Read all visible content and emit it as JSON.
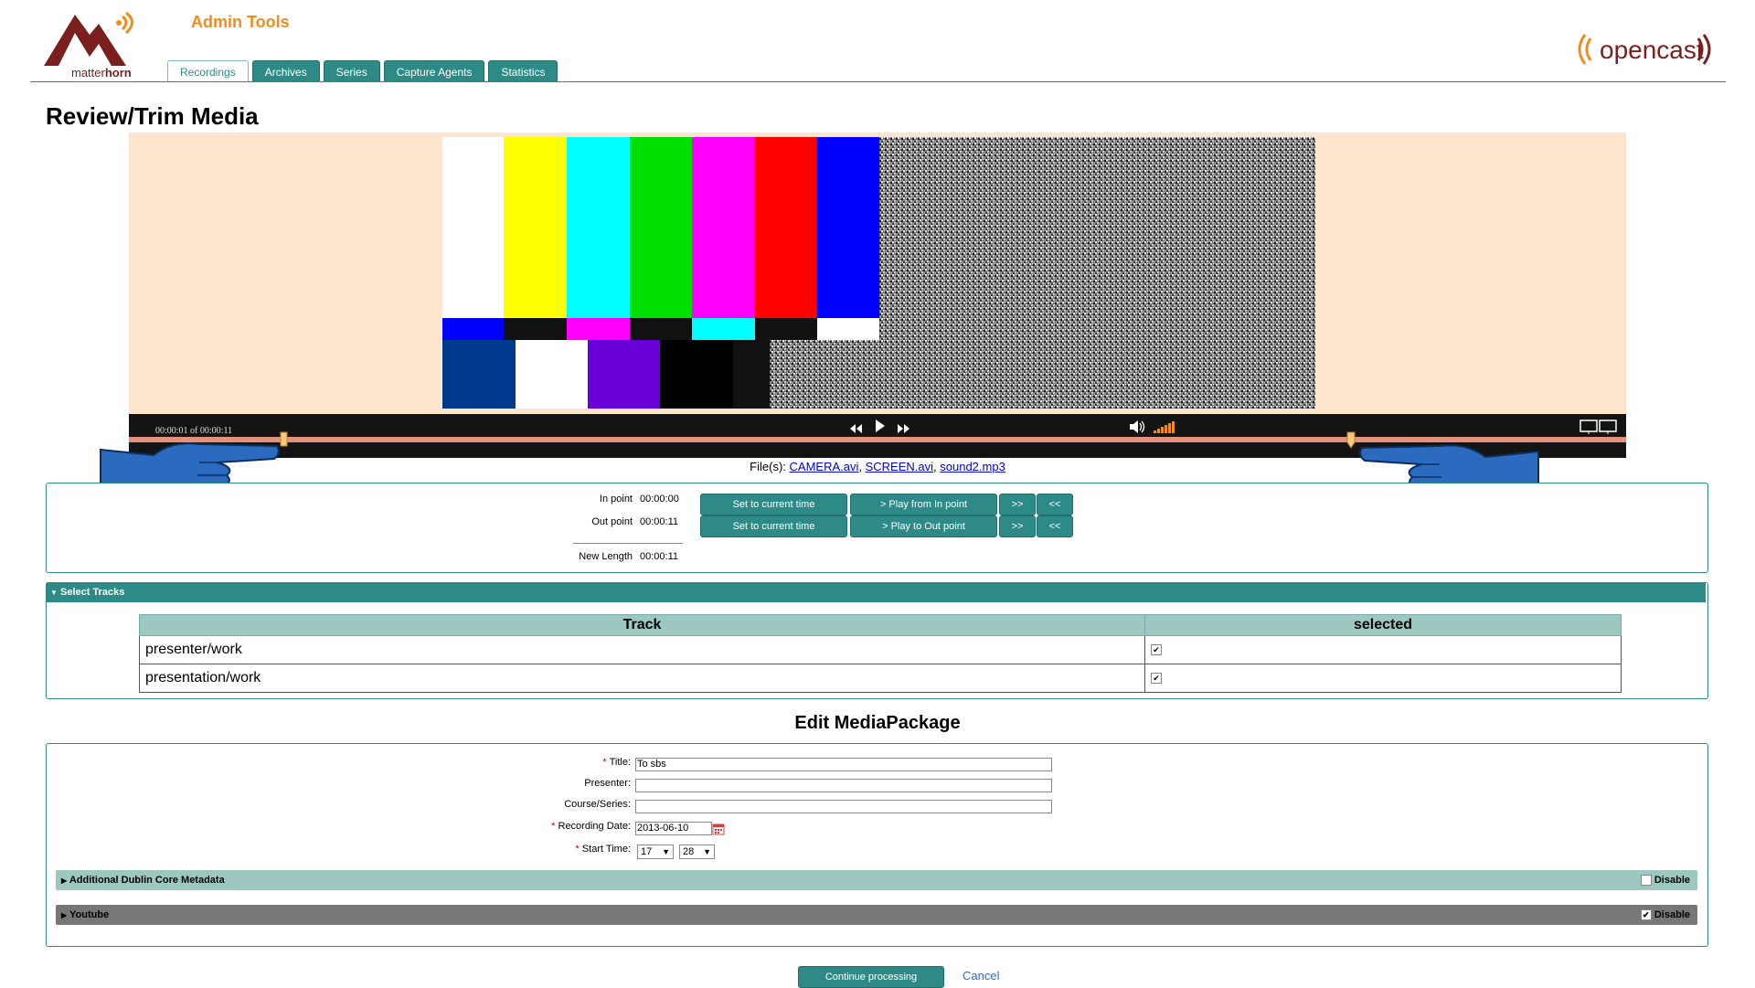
{
  "header": {
    "app_title": "Admin Tools",
    "tabs": [
      {
        "label": "Recordings",
        "active": true
      },
      {
        "label": "Archives",
        "active": false
      },
      {
        "label": "Series",
        "active": false
      },
      {
        "label": "Capture Agents",
        "active": false
      },
      {
        "label": "Statistics",
        "active": false
      }
    ],
    "brand_accent": "#f08c1e",
    "brand_teal": "#2d8a86"
  },
  "page_title": "Review/Trim Media",
  "player": {
    "time": "00:00:01  of  00:00:11",
    "files_label": "File(s):",
    "files": [
      "CAMERA.avi",
      "SCREEN.avi",
      "sound2.mp3"
    ]
  },
  "trim": {
    "in_label": "In point",
    "in_value": "00:00:00",
    "out_label": "Out point",
    "out_value": "00:00:11",
    "length_label": "New Length",
    "length_value": "00:00:11",
    "set_in": "Set to current time",
    "play_in": "> Play from In point",
    "set_out": "Set to current time",
    "play_out": "> Play to Out point",
    "fwd": ">>",
    "back": "<<"
  },
  "tracks": {
    "section_title": "Select Tracks",
    "col_track": "Track",
    "col_selected": "selected",
    "rows": [
      {
        "track": "presenter/work",
        "selected": "✔"
      },
      {
        "track": "presentation/work",
        "selected": "✔"
      }
    ]
  },
  "edit": {
    "section_title": "Edit MediaPackage",
    "title_label": "Title:",
    "title_value": "To sbs",
    "presenter_label": "Presenter:",
    "course_label": "Course/Series:",
    "date_label": "Recording Date:",
    "date_value": "2013-06-10",
    "start_label": "Start Time:",
    "start_hour": "17",
    "start_min": "28",
    "dublin_label": "Additional Dublin Core Metadata",
    "youtube_label": "Youtube",
    "disable_label": "Disable"
  },
  "actions": {
    "continue": "Continue processing",
    "cancel": "Cancel"
  }
}
